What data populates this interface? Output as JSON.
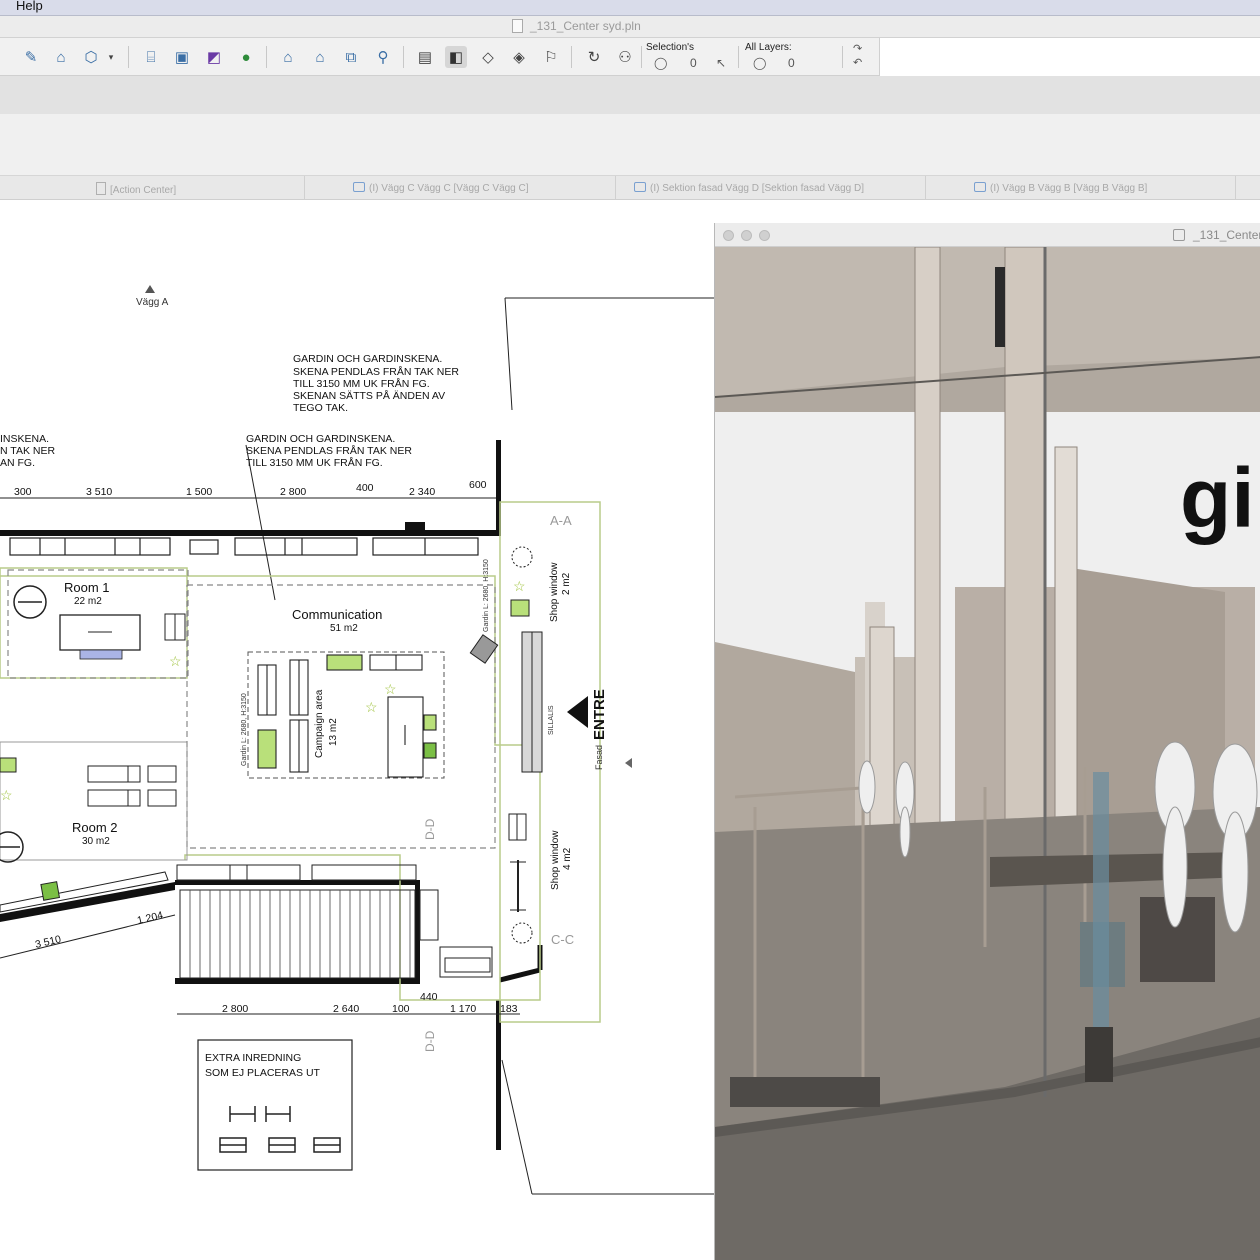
{
  "menubar": {
    "menu": "Help"
  },
  "window": {
    "title": "_131_Center syd.pln"
  },
  "toolbar": {
    "selection_label": "Selection's",
    "all_layers_label": "All Layers:",
    "selection_value": "0",
    "all_layers_value": "0"
  },
  "tabs": [
    {
      "label": "[Action Center]"
    },
    {
      "label": "(I) Vägg C Vägg C [Vägg C Vägg C]"
    },
    {
      "label": "(I) Sektion fasad Vägg D [Sektion fasad Vägg D]"
    },
    {
      "label": "(I) Vägg B Vägg B [Vägg B Vägg B]"
    }
  ],
  "plan": {
    "wall_a": "Vägg A",
    "note1": [
      "GARDIN OCH GARDINSKENA.",
      "SKENA PENDLAS FRÅN TAK NER",
      "TILL 3150 MM UK FRÅN FG.",
      "SKENAN SÄTTS PÅ ÄNDEN AV",
      "TEGO TAK."
    ],
    "note2": [
      "GARDIN OCH GARDINSKENA.",
      "SKENA PENDLAS FRÅN TAK NER",
      "TILL 3150 MM UK FRÅN FG."
    ],
    "note3": [
      "INSKENA.",
      "N TAK NER",
      "AN FG."
    ],
    "dims_top": [
      "300",
      "3 510",
      "1 500",
      "2 800",
      "400",
      "2 340",
      "600"
    ],
    "dims_bottom": [
      "2 800",
      "2 640",
      "100",
      "440",
      "1 170",
      "183"
    ],
    "dims_diag": [
      "3 510",
      "1 204"
    ],
    "room1": {
      "name": "Room 1",
      "area": "22 m2"
    },
    "room2": {
      "name": "Room 2",
      "area": "30 m2"
    },
    "communication": {
      "name": "Communication",
      "area": "51 m2"
    },
    "campaign": {
      "name": "Campaign area",
      "area": "13 m2"
    },
    "shop_window1": {
      "name": "Shop window",
      "area": "2 m2"
    },
    "shop_window2": {
      "name": "Shop window",
      "area": "4 m2"
    },
    "entre": "ENTRE",
    "fasad": "Fasad",
    "gardin1": "Gardin L: 2680, H:3150",
    "gardin2": "Gardin L: 2680, H:3150",
    "sillalis": "SILLALIS",
    "sec_aa": "A-A",
    "sec_cc": "C-C",
    "sec_dd1": "D-D",
    "sec_dd2": "D-D",
    "extra_title": [
      "EXTRA INREDNING",
      "SOM EJ PLACERAS UT"
    ]
  },
  "view3d": {
    "title": "_131_Center",
    "sign_text": "gi"
  },
  "colors": {
    "plan_line": "#111111",
    "room_outline": "#b9cc8a",
    "accent_green": "#a8d86a",
    "scene_wall": "#c9bfb6",
    "scene_floor": "#6e6a65"
  }
}
